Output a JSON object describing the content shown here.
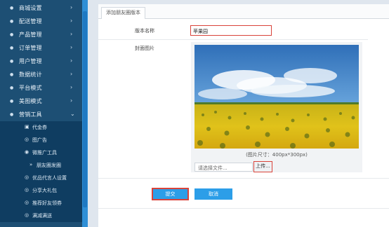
{
  "sidebar": {
    "items": [
      {
        "label": "商城设置",
        "icon": "circle-icon",
        "arrow": "›"
      },
      {
        "label": "配送管理",
        "icon": "circle-icon",
        "arrow": "›"
      },
      {
        "label": "产品管理",
        "icon": "circle-icon",
        "arrow": "›"
      },
      {
        "label": "订单管理",
        "icon": "circle-icon",
        "arrow": "›"
      },
      {
        "label": "用户管理",
        "icon": "circle-icon",
        "arrow": "›"
      },
      {
        "label": "数据统计",
        "icon": "circle-icon",
        "arrow": "›"
      },
      {
        "label": "平台模式",
        "icon": "circle-icon",
        "arrow": "›"
      },
      {
        "label": "美图模式",
        "icon": "circle-icon",
        "arrow": "›"
      },
      {
        "label": "营销工具",
        "icon": "circle-icon",
        "arrow": "⌄"
      }
    ],
    "subitems": [
      {
        "label": "代金券",
        "icon": "▣"
      },
      {
        "label": "图广告",
        "icon": "◎"
      },
      {
        "label": "微推广工具",
        "icon": "◉"
      }
    ],
    "subsub": {
      "label": "朋友圈发圈",
      "icon": "»"
    },
    "subitems2": [
      {
        "label": "优品代言人设置",
        "icon": "◎"
      },
      {
        "label": "分享大礼包",
        "icon": "◎"
      },
      {
        "label": "推荐好友领券",
        "icon": "◎"
      },
      {
        "label": "满减满送",
        "icon": "◎"
      }
    ]
  },
  "tab": {
    "label": "添加朋友圈版本"
  },
  "form": {
    "name_label": "版本名称",
    "name_value": "苹果园",
    "image_label": "封面图片",
    "image_caption": "(图片尺寸：400px*300px)",
    "file_placeholder": "请选择文件...",
    "upload_label": "上传...",
    "submit_label": "提交",
    "cancel_label": "取消"
  },
  "colors": {
    "sidebar_bg": "#1d4f74",
    "accent": "#2c9ee8",
    "highlight": "#d9433a"
  }
}
